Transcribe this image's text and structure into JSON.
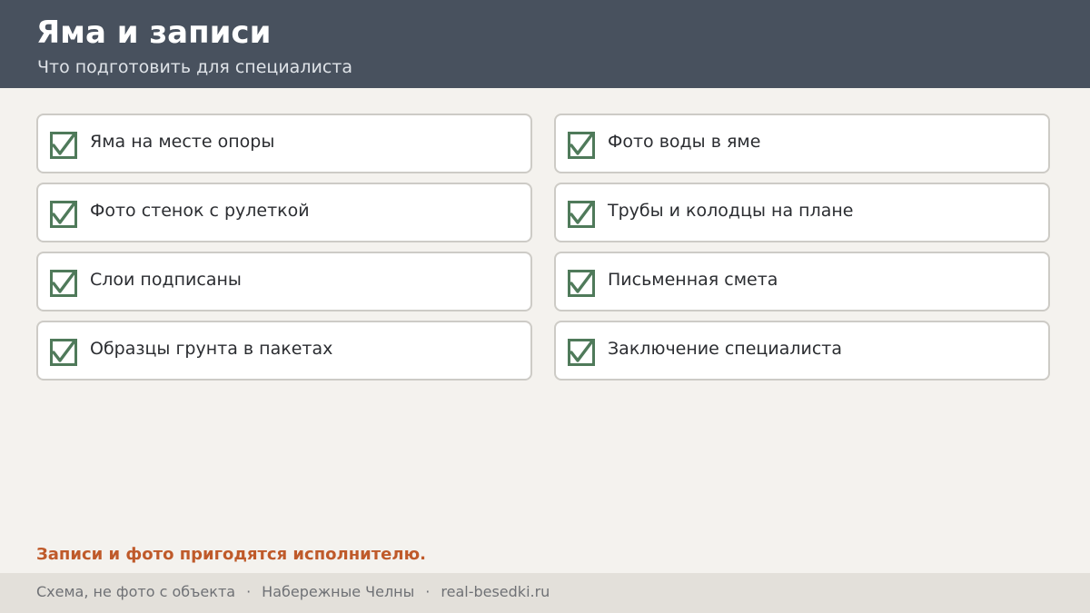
{
  "header": {
    "title": "Яма и записи",
    "subtitle": "Что подготовить для специалиста"
  },
  "checklist": {
    "check_icon": "checked-checkbox-icon",
    "check_color": "#4f7a5a",
    "items": [
      {
        "label": "Яма на месте опоры",
        "checked": true
      },
      {
        "label": "Фото воды в яме",
        "checked": true
      },
      {
        "label": "Фото стенок с рулеткой",
        "checked": true
      },
      {
        "label": "Трубы и колодцы на плане",
        "checked": true
      },
      {
        "label": "Слои подписаны",
        "checked": true
      },
      {
        "label": "Письменная смета",
        "checked": true
      },
      {
        "label": "Образцы грунта в пакетах",
        "checked": true
      },
      {
        "label": "Заключение специалиста",
        "checked": true
      }
    ]
  },
  "note": {
    "text": "Записи и фото пригодятся исполнителю.",
    "color": "#bf5a2a"
  },
  "footer": {
    "parts": [
      "Схема, не фото с объекта",
      "Набережные Челны",
      "real-besedki.ru"
    ],
    "separator": "·"
  },
  "colors": {
    "header_bg": "#48515e",
    "page_bg": "#f4f2ee",
    "footer_bg": "#e3e0da"
  }
}
